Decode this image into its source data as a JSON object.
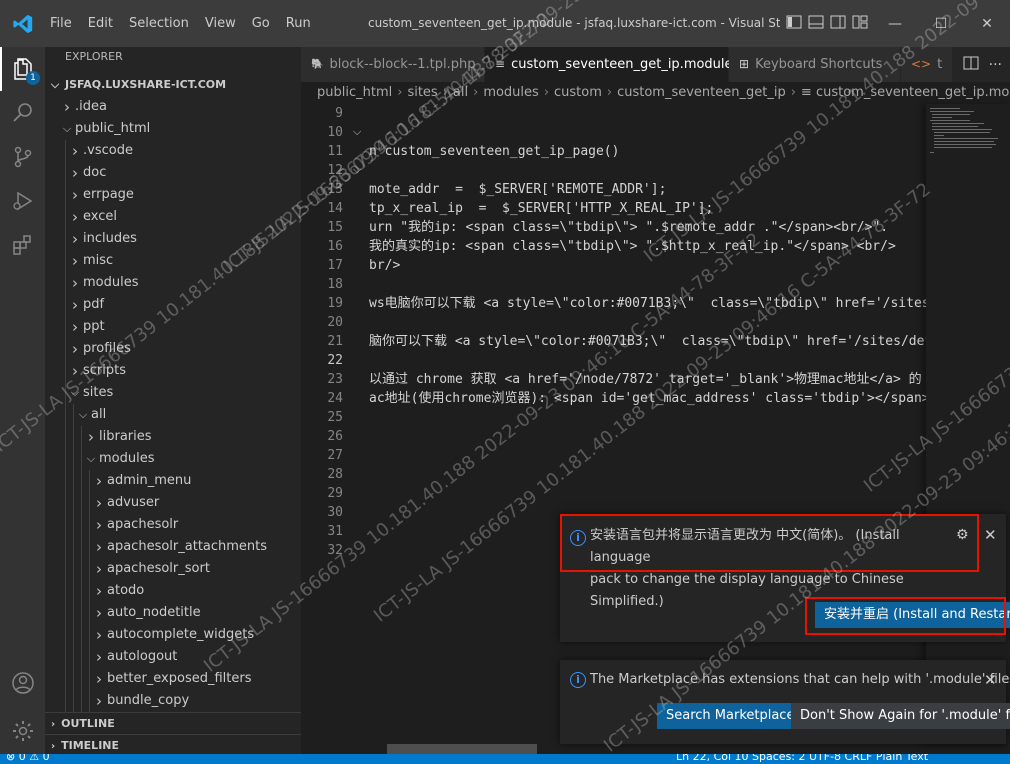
{
  "titlebar": {
    "menu": [
      "File",
      "Edit",
      "Selection",
      "View",
      "Go",
      "Run"
    ],
    "title": "custom_seventeen_get_ip.module - jsfaq.luxshare-ict.com - Visual Studio Co..."
  },
  "activitybar": {
    "explorer_badge": "1"
  },
  "sidebar": {
    "title": "EXPLORER",
    "root": "JSFAQ.LUXSHARE-ICT.COM",
    "items": [
      {
        "label": ".idea",
        "depth": 1,
        "open": false
      },
      {
        "label": "public_html",
        "depth": 1,
        "open": true
      },
      {
        "label": ".vscode",
        "depth": 2,
        "open": false
      },
      {
        "label": "doc",
        "depth": 2,
        "open": false
      },
      {
        "label": "errpage",
        "depth": 2,
        "open": false
      },
      {
        "label": "excel",
        "depth": 2,
        "open": false
      },
      {
        "label": "includes",
        "depth": 2,
        "open": false
      },
      {
        "label": "misc",
        "depth": 2,
        "open": false
      },
      {
        "label": "modules",
        "depth": 2,
        "open": false
      },
      {
        "label": "pdf",
        "depth": 2,
        "open": false
      },
      {
        "label": "ppt",
        "depth": 2,
        "open": false
      },
      {
        "label": "profiles",
        "depth": 2,
        "open": false
      },
      {
        "label": "scripts",
        "depth": 2,
        "open": false
      },
      {
        "label": "sites",
        "depth": 2,
        "open": true
      },
      {
        "label": "all",
        "depth": 3,
        "open": true
      },
      {
        "label": "libraries",
        "depth": 4,
        "open": false
      },
      {
        "label": "modules",
        "depth": 4,
        "open": true
      },
      {
        "label": "admin_menu",
        "depth": 5,
        "open": false
      },
      {
        "label": "advuser",
        "depth": 5,
        "open": false
      },
      {
        "label": "apachesolr",
        "depth": 5,
        "open": false
      },
      {
        "label": "apachesolr_attachments",
        "depth": 5,
        "open": false
      },
      {
        "label": "apachesolr_sort",
        "depth": 5,
        "open": false
      },
      {
        "label": "atodo",
        "depth": 5,
        "open": false
      },
      {
        "label": "auto_nodetitle",
        "depth": 5,
        "open": false
      },
      {
        "label": "autocomplete_widgets",
        "depth": 5,
        "open": false
      },
      {
        "label": "autologout",
        "depth": 5,
        "open": false
      },
      {
        "label": "better_exposed_filters",
        "depth": 5,
        "open": false
      },
      {
        "label": "bundle_copy",
        "depth": 5,
        "open": false
      }
    ],
    "outline": "OUTLINE",
    "timeline": "TIMELINE"
  },
  "tabs": [
    {
      "label": "block--block--1.tpl.php",
      "active": false
    },
    {
      "label": "custom_seventeen_get_ip.module",
      "active": true
    },
    {
      "label": "Keyboard Shortcuts",
      "active": false
    },
    {
      "label": "t",
      "active": false
    }
  ],
  "breadcrumb": [
    "public_html",
    "sites",
    "all",
    "modules",
    "custom",
    "custom_seventeen_get_ip",
    "custom_seventeen_get_ip.module"
  ],
  "editor": {
    "lines": [
      {
        "n": "9",
        "text": ""
      },
      {
        "n": "10",
        "text": "",
        "fold": true
      },
      {
        "n": "11",
        "text": "n custom_seventeen_get_ip_page()"
      },
      {
        "n": "12",
        "text": "",
        "fold": true
      },
      {
        "n": "13",
        "text": "mote_addr  =  $_SERVER['REMOTE_ADDR'];"
      },
      {
        "n": "14",
        "text": "tp_x_real_ip  =  $_SERVER['HTTP_X_REAL_IP'];"
      },
      {
        "n": "15",
        "text": "urn \"我的ip: <span class=\\\"tbdip\\\"> \".$remote_addr .\"</span><br/>\"."
      },
      {
        "n": "16",
        "text": "我的真实的ip: <span class=\\\"tbdip\\\"> \".$http_x_real_ip.\"</span> <br/>"
      },
      {
        "n": "17",
        "text": "br/>"
      },
      {
        "n": "18",
        "text": ""
      },
      {
        "n": "19",
        "text": "ws电脑你可以下载 <a style=\\\"color:#0071B3;\\\"  class=\\\"tbdip\\\" href='/sites"
      },
      {
        "n": "20",
        "text": ""
      },
      {
        "n": "21",
        "text": "脑你可以下载 <a style=\\\"color:#0071B3;\\\"  class=\\\"tbdip\\\" href='/sites/def"
      },
      {
        "n": "22",
        "text": ""
      },
      {
        "n": "23",
        "text": "以通过 chrome 获取 <a href='/node/7872' target='_blank'>物理mac地址</a> 的"
      },
      {
        "n": "24",
        "text": "ac地址(使用chrome浏览器): <span id='get_mac_address' class='tbdip'></span>"
      },
      {
        "n": "25",
        "text": ""
      },
      {
        "n": "26",
        "text": ""
      },
      {
        "n": "27",
        "text": ""
      },
      {
        "n": "28",
        "text": ""
      },
      {
        "n": "29",
        "text": ""
      },
      {
        "n": "30",
        "text": ""
      },
      {
        "n": "31",
        "text": ""
      },
      {
        "n": "32",
        "text": ""
      }
    ],
    "current_line": "22"
  },
  "notifications": {
    "language": {
      "message_cn": "安装语言包并将显示语言更改为 中文(简体)。",
      "message_en_1": "(Install language",
      "message_en_2": "pack to change the display language to Chinese Simplified.)",
      "button": "安装并重启 (Install and Restart)"
    },
    "marketplace": {
      "message": "The Marketplace has extensions that can help with '.module' files",
      "search_button": "Search Marketplace",
      "dont_show_button": "Don't Show Again for '.module' files"
    }
  },
  "statusbar": {
    "left": "⊗ 0 ⚠ 0",
    "right": "Ln 22, Col 10   Spaces: 2   UTF-8   CRLF   Plain Text"
  },
  "watermark": "ICT-JS-LA  JS-16666739  10.181.40.188  2022-09-23 09:46:16  C-5A-44-78-3F-72",
  "colors": {
    "accent": "#007acc",
    "highlight_box": "#e51400",
    "button_primary": "#0e639c",
    "info": "#3794ff"
  }
}
